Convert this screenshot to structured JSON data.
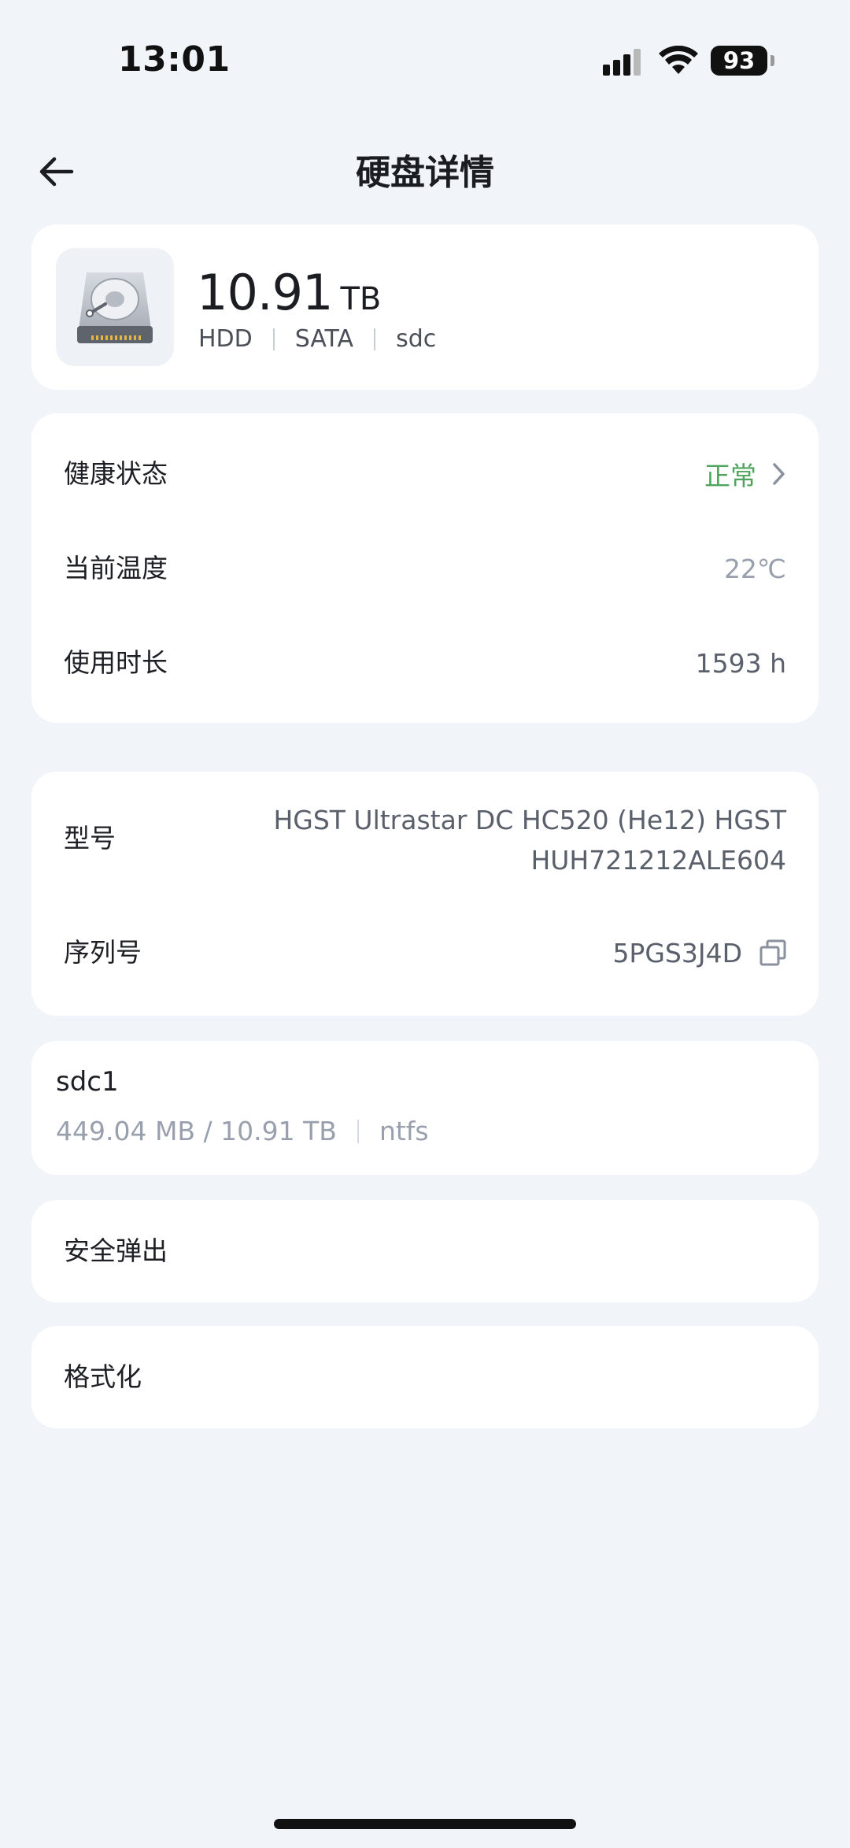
{
  "status_bar": {
    "time": "13:01",
    "battery": "93",
    "icons": [
      "signal-icon",
      "wifi-icon",
      "battery-icon"
    ]
  },
  "nav": {
    "title": "硬盘详情",
    "back_icon": "arrow-left-icon"
  },
  "disk": {
    "icon": "hard-disk-icon",
    "size_value": "10.91",
    "size_unit": "TB",
    "type": "HDD",
    "interface": "SATA",
    "device": "sdc"
  },
  "info": {
    "health_label": "健康状态",
    "health_value": "正常",
    "health_color": "#4fa55c",
    "temperature_label": "当前温度",
    "temperature_value": "22℃",
    "uptime_label": "使用时长",
    "uptime_value": "1593 h"
  },
  "model": {
    "model_label": "型号",
    "model_line1": "HGST Ultrastar DC HC520 (He12) HGST",
    "model_line2": "HUH721212ALE604",
    "serial_label": "序列号",
    "serial_value": "5PGS3J4D",
    "copy_icon": "copy-icon"
  },
  "partition": {
    "name": "sdc1",
    "usage": "449.04 MB / 10.91 TB",
    "filesystem": "ntfs"
  },
  "actions": {
    "eject_label": "安全弹出",
    "format_label": "格式化"
  },
  "colors": {
    "background": "#f1f4f9",
    "card": "#ffffff",
    "muted_text": "#98a0ad"
  }
}
